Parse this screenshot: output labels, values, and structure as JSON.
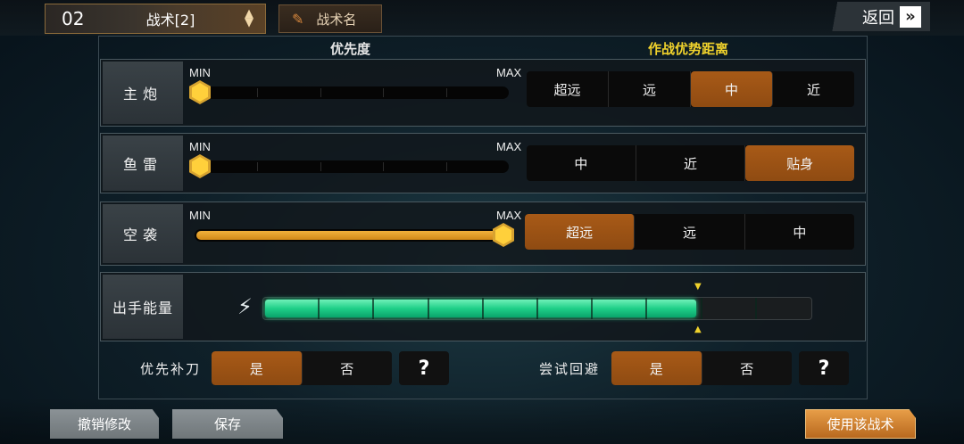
{
  "top": {
    "tactic_number": "02",
    "tactic_name": "战术[2]",
    "name_button": "战术名",
    "back_label": "返回"
  },
  "headers": {
    "priority": "优先度",
    "distance": "作战优势距离"
  },
  "slider_labels": {
    "min": "MIN",
    "max": "MAX"
  },
  "weapons": [
    {
      "label": "主炮",
      "priority": 0,
      "options": [
        "超远",
        "远",
        "中",
        "近"
      ],
      "selected": 2
    },
    {
      "label": "鱼雷",
      "priority": 0,
      "options": [
        "中",
        "近",
        "贴身"
      ],
      "selected": 2
    },
    {
      "label": "空袭",
      "priority": 1,
      "options": [
        "超远",
        "远",
        "中"
      ],
      "selected": 0
    }
  ],
  "energy": {
    "label": "出手能量",
    "level": 0.79,
    "segments": 10
  },
  "toggles": [
    {
      "label": "优先补刀",
      "yes": "是",
      "no": "否",
      "selected": "yes",
      "help": "?"
    },
    {
      "label": "尝试回避",
      "yes": "是",
      "no": "否",
      "selected": "yes",
      "help": "?"
    }
  ],
  "bottom": {
    "cancel_label": "撤销修改",
    "save_label": "保存",
    "use_label": "使用该战术"
  },
  "colors": {
    "accent": "#a85a17",
    "energy": "#1fcf88",
    "highlight": "#f0d22c"
  }
}
